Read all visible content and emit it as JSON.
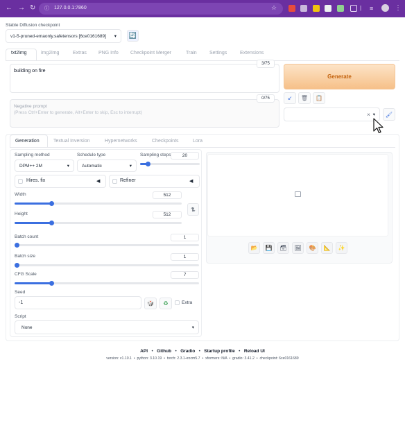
{
  "browser": {
    "url": "127.0.0.1:7860"
  },
  "checkpoint": {
    "label": "Stable Diffusion checkpoint",
    "value": "v1-5-pruned-emaonly.safetensors [6ce0161689]",
    "refresh_icon": "refresh-icon"
  },
  "tabs": [
    "txt2img",
    "img2img",
    "Extras",
    "PNG Info",
    "Checkpoint Merger",
    "Train",
    "Settings",
    "Extensions"
  ],
  "prompt": {
    "value": "building on fire",
    "counter": "3/75"
  },
  "negative_prompt": {
    "label": "Negative prompt",
    "placeholder": "(Press Ctrl+Enter to generate, Alt+Enter to skip, Esc to interrupt)",
    "counter": "0/75"
  },
  "generate_label": "Generate",
  "style_clear": "×",
  "subtabs": [
    "Generation",
    "Textual Inversion",
    "Hypernetworks",
    "Checkpoints",
    "Lora"
  ],
  "sampling": {
    "method_label": "Sampling method",
    "method_value": "DPM++ 2M",
    "schedule_label": "Schedule type",
    "schedule_value": "Automatic",
    "steps_label": "Sampling steps",
    "steps_value": "20",
    "steps_fraction": 0.13
  },
  "hires": {
    "label": "Hires. fix"
  },
  "refiner": {
    "label": "Refiner"
  },
  "width": {
    "label": "Width",
    "value": "512",
    "fraction": 0.22
  },
  "height": {
    "label": "Height",
    "value": "512",
    "fraction": 0.22
  },
  "batch_count": {
    "label": "Batch count",
    "value": "1",
    "fraction": 0.0
  },
  "batch_size": {
    "label": "Batch size",
    "value": "1",
    "fraction": 0.0
  },
  "cfg": {
    "label": "CFG Scale",
    "value": "7",
    "fraction": 0.2
  },
  "seed": {
    "label": "Seed",
    "value": "-1",
    "extra_label": "Extra"
  },
  "script": {
    "label": "Script",
    "value": "None"
  },
  "footer": {
    "links": [
      "API",
      "Github",
      "Gradio",
      "Startup profile",
      "Reload UI"
    ],
    "separator": "•",
    "versions": "version: v1.10.1  •  python: 3.10.19  •  torch: 2.3.1+rocm5.7  •  xformers: N/A  •  gradio: 3.41.2  •  checkpoint: 6ce0161689"
  },
  "colors": {
    "browser_bar": "#6a2fa0",
    "generate_gradient_start": "#fbd9b4",
    "generate_gradient_end": "#f6c089",
    "generate_text": "#c2610c",
    "slider": "#3b6fe0"
  }
}
